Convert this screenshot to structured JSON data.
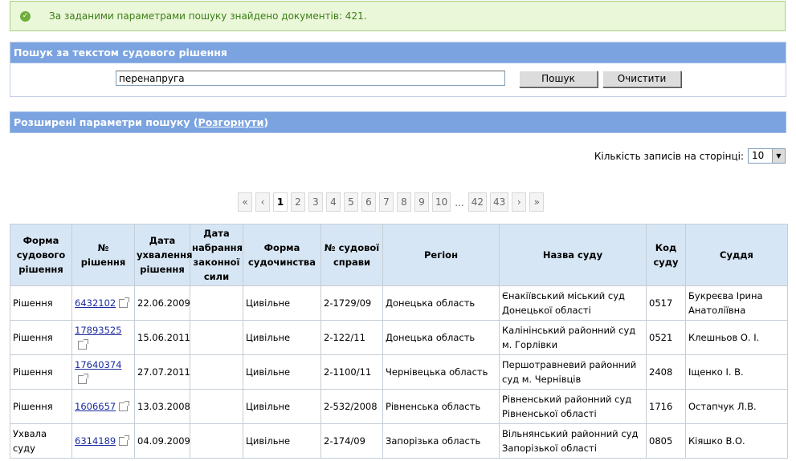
{
  "status": {
    "message": "За заданими параметрами пошуку знайдено документів: 421."
  },
  "search": {
    "title": "Пошук за текстом судового рішення",
    "value": "перенапруга",
    "search_label": "Пошук",
    "clear_label": "Очистити"
  },
  "advanced": {
    "title": "Розширені параметри пошуку (",
    "link": "Розгорнути",
    "close": ")"
  },
  "per_page": {
    "label": "Кількість записів на сторінці:",
    "value": "10"
  },
  "pager": {
    "first": "«",
    "prev": "‹",
    "pages": [
      "1",
      "2",
      "3",
      "4",
      "5",
      "6",
      "7",
      "8",
      "9",
      "10"
    ],
    "ellipsis": "...",
    "tail": [
      "42",
      "43"
    ],
    "next": "›",
    "last": "»",
    "current": "1"
  },
  "table": {
    "headers": [
      "Форма судового рішення",
      "№ рішення",
      "Дата ухвалення рішення",
      "Дата набрання законної сили",
      "Форма судочинства",
      "№ судової справи",
      "Регіон",
      "Назва суду",
      "Код суду",
      "Суддя"
    ],
    "rows": [
      [
        "Рішення",
        "6432102",
        "22.06.2009",
        "",
        "Цивільне",
        "2-1729/09",
        "Донецька область",
        "Єнакіївський міський суд Донецької області",
        "0517",
        "Букреєва Ірина Анатоліївна"
      ],
      [
        "Рішення",
        "17893525",
        "15.06.2011",
        "",
        "Цивільне",
        "2-122/11",
        "Донецька область",
        "Калінінський районний суд м. Горлівки",
        "0521",
        "Клешньов О. І."
      ],
      [
        "Рішення",
        "17640374",
        "27.07.2011",
        "",
        "Цивільне",
        "2-1100/11",
        "Чернівецька область",
        "Першотравневий районний суд м. Чернівців",
        "2408",
        "Іщенко І. В."
      ],
      [
        "Рішення",
        "1606657",
        "13.03.2008",
        "",
        "Цивільне",
        "2-532/2008",
        "Рівненська область",
        "Рівненський районний суд Рівненської області",
        "1716",
        "Остапчук Л.В."
      ],
      [
        "Ухвала суду",
        "6314189",
        "04.09.2009",
        "",
        "Цивільне",
        "2-174/09",
        "Запорізька область",
        "Вільнянський районний суд Запорізької області",
        "0805",
        "Кіяшко В.О."
      ]
    ]
  },
  "colors": {
    "header_blue": "#7aa3e0",
    "table_header": "#d7e6f4",
    "success_bg": "#eaf7d9",
    "success_text": "#3b7d16",
    "link": "#1b2b9f"
  }
}
